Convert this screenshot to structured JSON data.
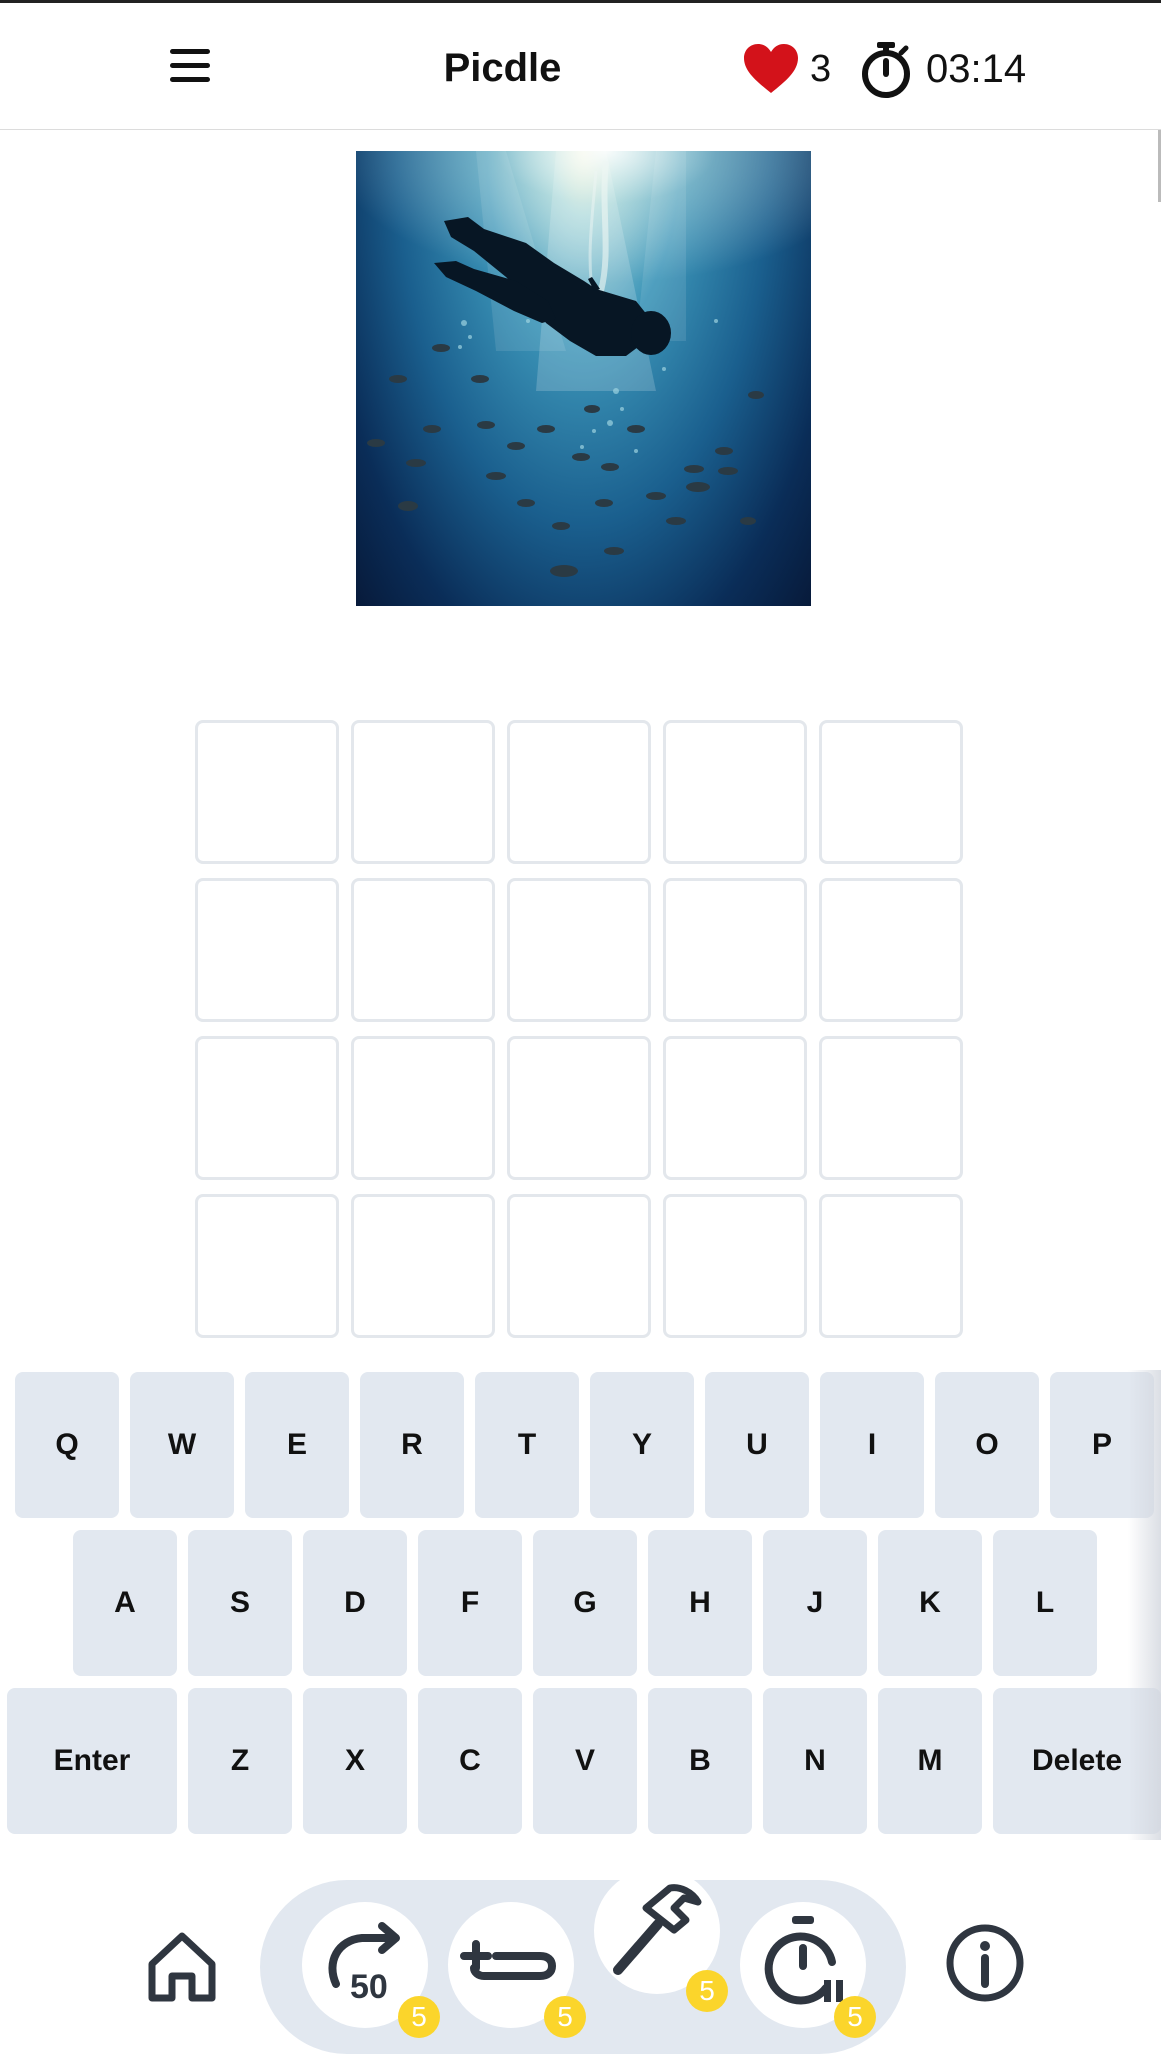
{
  "header": {
    "title": "Picdle",
    "lives": "3",
    "timer": "03:14",
    "heart_color": "#d3121a"
  },
  "puzzle": {
    "image": "underwater silhouette of a diver swimming toward sunlit surface with a school of fish",
    "rows": 4,
    "columns": 5
  },
  "keyboard": {
    "rows": [
      [
        "Q",
        "W",
        "E",
        "R",
        "T",
        "Y",
        "U",
        "I",
        "O",
        "P"
      ],
      [
        "A",
        "S",
        "D",
        "F",
        "G",
        "H",
        "J",
        "K",
        "L"
      ],
      [
        "Enter",
        "Z",
        "X",
        "C",
        "V",
        "B",
        "N",
        "M",
        "Delete"
      ]
    ]
  },
  "toolbar": {
    "powerups": [
      {
        "icon": "reveal-50-icon",
        "badge": "5"
      },
      {
        "icon": "add-row-icon",
        "badge": "5"
      },
      {
        "icon": "hammer-icon",
        "badge": "5"
      },
      {
        "icon": "pause-timer-icon",
        "badge": "5"
      }
    ],
    "home_icon": "home-icon",
    "info_icon": "info-icon",
    "badge_color": "#fbd52b",
    "bar_color": "#e2e8f0"
  }
}
